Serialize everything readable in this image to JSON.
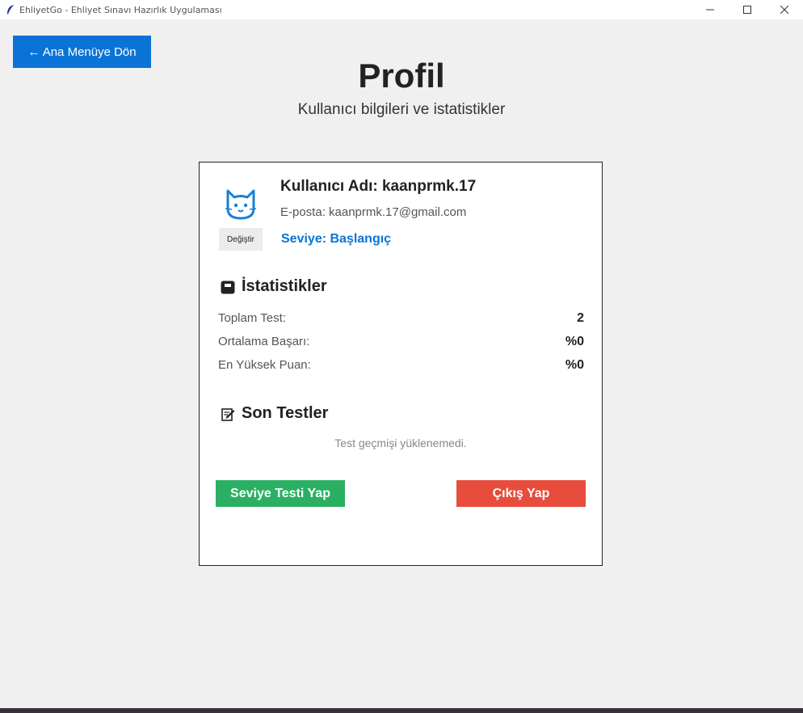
{
  "window": {
    "title": "EhliyetGo - Ehliyet Sınavı Hazırlık Uygulaması"
  },
  "nav": {
    "back_label": "← Ana Menüye Dön"
  },
  "header": {
    "title": "Profil",
    "subtitle": "Kullanıcı bilgileri ve istatistikler"
  },
  "profile": {
    "avatar_icon": "cat-face-icon",
    "change_label": "Değiştir",
    "username": "Kullanıcı Adı: kaanprmk.17",
    "email": "E-posta: kaanprmk.17@gmail.com",
    "level": "Seviye: Başlangıç"
  },
  "stats": {
    "title": "İstatistikler",
    "icon": "card-box-icon",
    "rows": [
      {
        "label": "Toplam Test:",
        "value": "2"
      },
      {
        "label": "Ortalama Başarı:",
        "value": "%0"
      },
      {
        "label": "En Yüksek Puan:",
        "value": "%0"
      }
    ]
  },
  "recent_tests": {
    "title": "Son Testler",
    "icon": "memo-pencil-icon",
    "empty_message": "Test geçmişi yüklenemedi."
  },
  "actions": {
    "level_test_label": "Seviye Testi Yap",
    "logout_label": "Çıkış Yap"
  },
  "colors": {
    "accent": "#0a74d6",
    "success": "#2bb063",
    "danger": "#e84c3d"
  }
}
